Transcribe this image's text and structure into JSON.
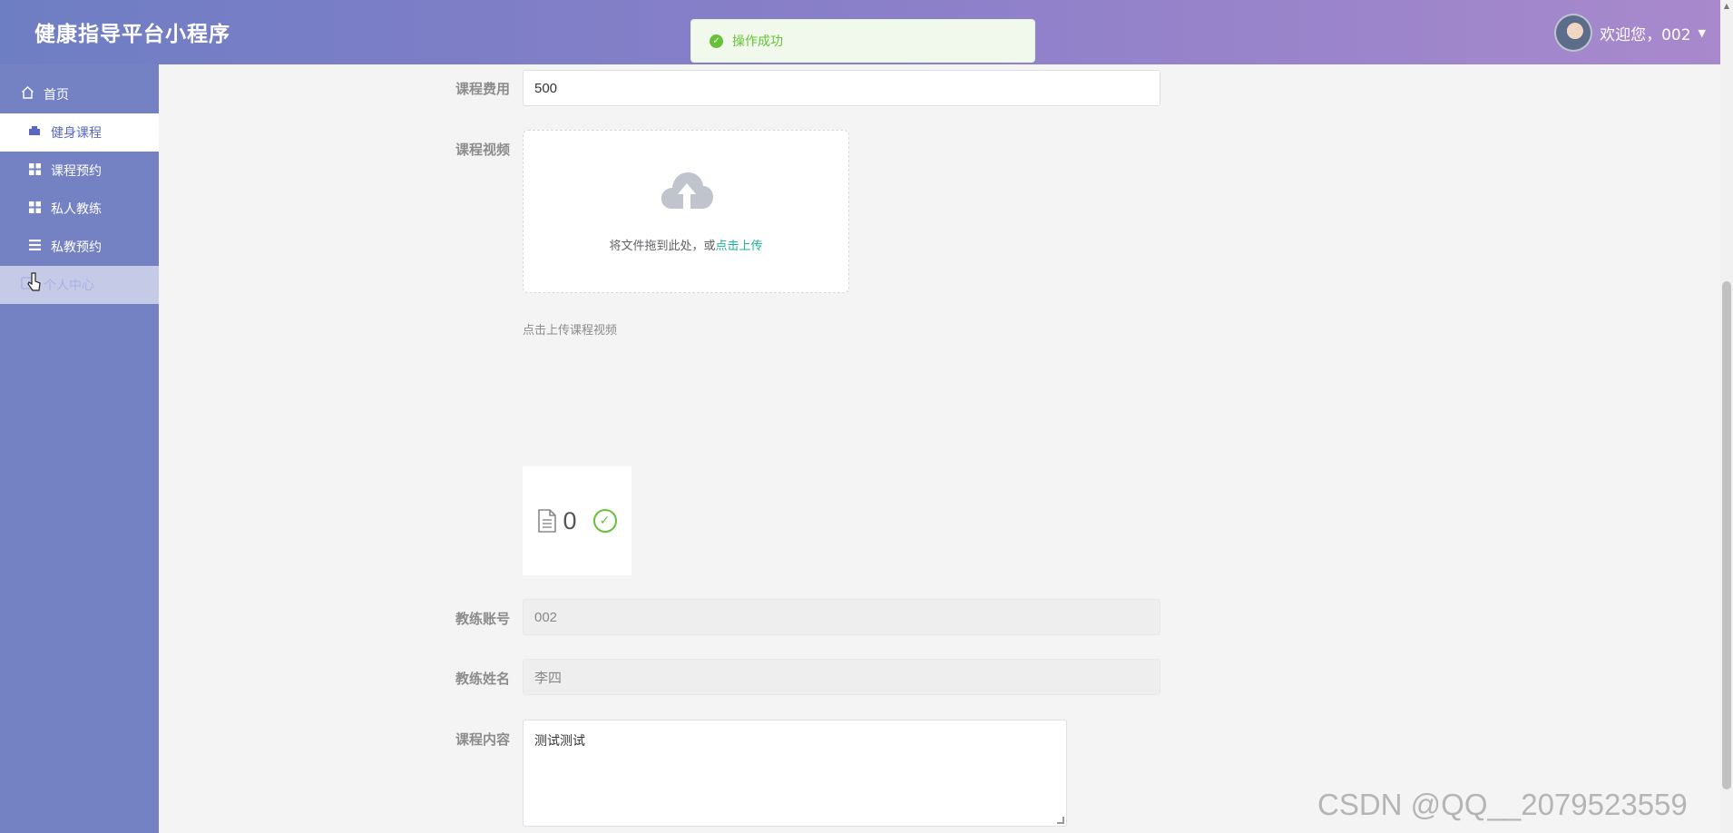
{
  "header": {
    "app_title": "健康指导平台小程序",
    "welcome_text": "欢迎您，002",
    "caret": "▼"
  },
  "toast": {
    "message": "操作成功",
    "status_color": "#67c23a"
  },
  "sidebar": {
    "items": [
      {
        "label": "首页",
        "icon": "home-icon"
      },
      {
        "label": "健身课程",
        "icon": "course-icon",
        "active": true
      },
      {
        "label": "课程预约",
        "icon": "grid-icon"
      },
      {
        "label": "私人教练",
        "icon": "grid-icon"
      },
      {
        "label": "私教预约",
        "icon": "list-icon"
      },
      {
        "label": "个人中心",
        "icon": "user-icon",
        "hovered": true
      }
    ]
  },
  "form": {
    "fee_label": "课程费用",
    "fee_value": "500",
    "video_label": "课程视频",
    "upload_text": "将文件拖到此处，或",
    "upload_link": "点击上传",
    "upload_tip": "点击上传课程视频",
    "uploaded_file_name": "0",
    "coach_account_label": "教练账号",
    "coach_account_value": "002",
    "coach_name_label": "教练姓名",
    "coach_name_value": "李四",
    "content_label": "课程内容",
    "content_value": "测试测试"
  },
  "watermark": "CSDN @QQ__2079523559",
  "colors": {
    "header_gradient_start": "#6e7ec3",
    "header_gradient_end": "#a989cc",
    "sidebar_bg": "#7482c4",
    "active_text": "#5a67c5",
    "link": "#1ab394"
  }
}
